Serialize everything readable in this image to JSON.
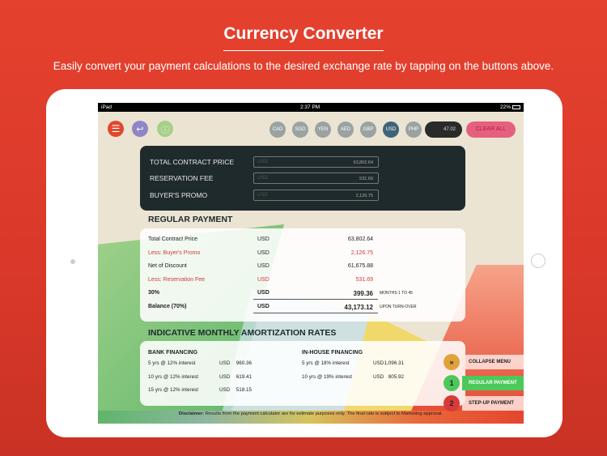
{
  "header": {
    "title": "Currency Converter",
    "subtitle": "Easily convert your payment calculations to the desired exchange rate by tapping on the buttons above."
  },
  "status_bar": {
    "device": "iPad",
    "time": "2:37 PM",
    "battery": "22%"
  },
  "toolbar": {
    "currencies": [
      "CAD",
      "SGD",
      "YEN",
      "AED",
      "GBP",
      "USD",
      "PHP"
    ],
    "selected": "USD",
    "rate": "47.02",
    "clear_label": "CLEAR ALL",
    "icons": [
      "menu-icon",
      "back-icon",
      "info-icon"
    ]
  },
  "inputs": [
    {
      "label": "TOTAL CONTRACT PRICE",
      "placeholder": "USD",
      "value": "63,802.64"
    },
    {
      "label": "RESERVATION FEE",
      "placeholder": "USD",
      "value": "531.69"
    },
    {
      "label": "BUYER'S PROMO",
      "placeholder": "USD",
      "value": "2,126.75"
    }
  ],
  "regular": {
    "title": "REGULAR PAYMENT",
    "rows": [
      {
        "label": "Total Contract Price",
        "cur": "USD",
        "value": "63,802.64",
        "note": "",
        "style": ""
      },
      {
        "label": "Less: Buyer's Promo",
        "cur": "USD",
        "value": "2,126.75",
        "note": "",
        "style": "red"
      },
      {
        "label": "Net of Discount",
        "cur": "USD",
        "value": "61,675.88",
        "note": "",
        "style": ""
      },
      {
        "label": "Less: Reservation Fee",
        "cur": "USD",
        "value": "531.69",
        "note": "",
        "style": "red"
      },
      {
        "label": "30%",
        "cur": "USD",
        "value": "399.36",
        "note": "MONTHS 1 TO 45",
        "style": "b"
      },
      {
        "label": "Balance (70%)",
        "cur": "USD",
        "value": "43,173.12",
        "note": "UPON TURN-OVER",
        "style": "b"
      }
    ]
  },
  "amort": {
    "title": "INDICATIVE MONTHLY AMORTIZATION RATES",
    "bank": {
      "title": "BANK FINANCING",
      "rows": [
        {
          "label": "5 yrs @ 12% interest",
          "cur": "USD",
          "value": "960.36"
        },
        {
          "label": "10 yrs @ 12% interest",
          "cur": "USD",
          "value": "619.41"
        },
        {
          "label": "15 yrs @ 12% interest",
          "cur": "USD",
          "value": "518.15"
        }
      ]
    },
    "inhouse": {
      "title": "IN-HOUSE FINANCING",
      "rows": [
        {
          "label": "5 yrs @ 18% interest",
          "cur": "USD",
          "value": "1,096.31"
        },
        {
          "label": "10 yrs @ 19% interest",
          "cur": "USD",
          "value": "805.92"
        }
      ]
    }
  },
  "side_menu": [
    {
      "icon": "»",
      "label": "COLLAPSE MENU",
      "color": "#e0a23a"
    },
    {
      "icon": "1",
      "label": "REGULAR PAYMENT",
      "color": "#4cc95a",
      "active": true
    },
    {
      "icon": "2",
      "label": "STEP-UP PAYMENT",
      "color": "#d63a3a"
    }
  ],
  "disclaimer": {
    "label": "Disclaimer:",
    "text": " Results from the payment calculator are for estimate purposes only. The final rate is subject to Marketing approval."
  },
  "colors": {
    "background": "#e0402d",
    "clear": "#e5607e",
    "selected_currency": "#3e6478",
    "dark_panel": "#1f2a2d"
  }
}
